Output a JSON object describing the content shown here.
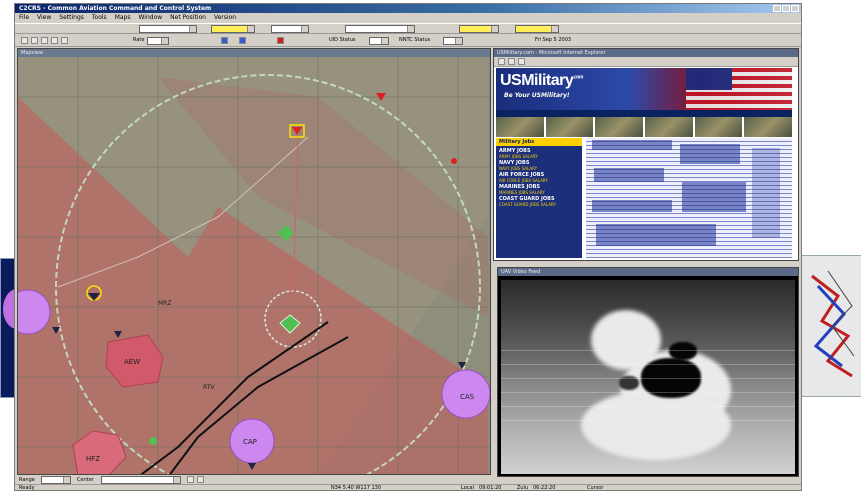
{
  "app": {
    "title": "C2CRS - Common Aviation Command and Control System",
    "menu": [
      "File",
      "View",
      "Settings",
      "Tools",
      "Maps",
      "Window",
      "Net Position",
      "Version"
    ]
  },
  "toolbar": {
    "scale_label": "Rate",
    "status_labels": [
      "UID Status",
      "NNTC Status"
    ],
    "timestamp": "Fri Sep 5 2003"
  },
  "map": {
    "pane_title": "Mapview",
    "zones": [
      {
        "label": "AEW"
      },
      {
        "label": "CAP"
      },
      {
        "label": "CAS"
      },
      {
        "label": "HFZ"
      },
      {
        "label": "MRZ"
      }
    ],
    "route_label": "RTV",
    "bottom": {
      "range_label": "Range",
      "center_label": "Center"
    }
  },
  "web": {
    "pane_title": "USMilitary.com - Microsoft Internet Explorer",
    "logo": "USMilitary",
    "logo_suffix": ".com",
    "tagline": "Be Your USMilitary!",
    "sidebar_head": "Military Jobs",
    "jobs": [
      {
        "name": "ARMY JOBS",
        "sub": "ARMY JOBS  SALARY"
      },
      {
        "name": "NAVY JOBS",
        "sub": "NAVY JOBS  SALARY"
      },
      {
        "name": "AIR FORCE JOBS",
        "sub": "AIR FORCE JOBS  SALARY"
      },
      {
        "name": "MARINES JOBS",
        "sub": "MARINES JOBS  SALARY"
      },
      {
        "name": "COAST GUARD JOBS",
        "sub": "COAST GUARD JOBS  SALARY"
      }
    ]
  },
  "video": {
    "pane_title": "UAV Video Feed"
  },
  "status": {
    "left": "Ready",
    "center": "N34 5.40  W117 130",
    "local_label": "Local",
    "local_value": "09:01:20",
    "zulu_label": "Zulu",
    "zulu_value": "06:22:20",
    "cursor_label": "Cursor"
  },
  "colors": {
    "map_bg": "#8f8e7c",
    "zone_red": "#c45a5a",
    "zone_magenta": "#cc88ee",
    "ring": "#c8e0c8",
    "accent_yellow": "#ffef5a",
    "title_blue": "#0a246a"
  }
}
